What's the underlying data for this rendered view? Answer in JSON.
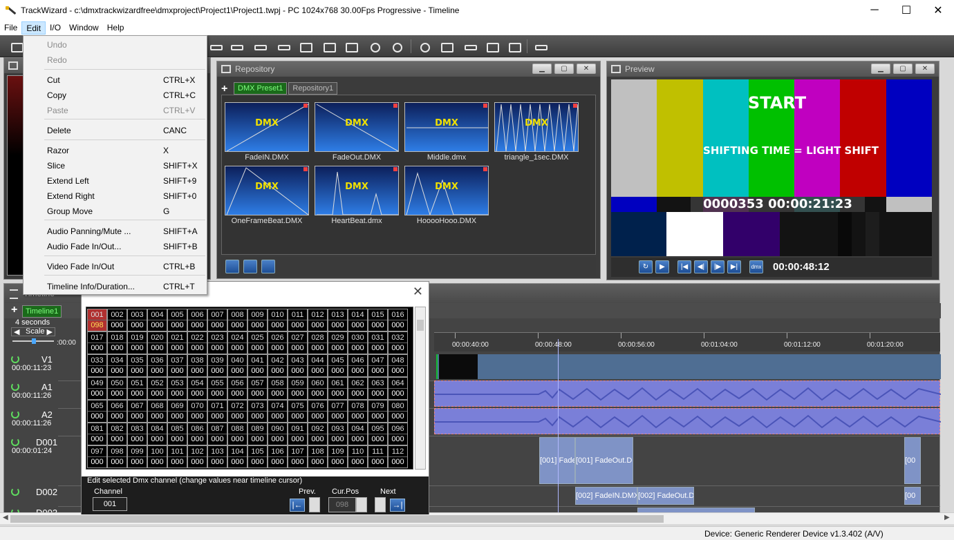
{
  "window": {
    "title": "TrackWizard - c:\\dmxtrackwizardfree\\dmxproject\\Project1\\Project1.twpj - PC 1024x768 30.00Fps Progressive - Timeline",
    "minimize": "─",
    "maximize": "☐",
    "close": "✕"
  },
  "menubar": [
    "File",
    "Edit",
    "I/O",
    "Window",
    "Help"
  ],
  "edit_menu": {
    "items": [
      {
        "label": "Undo",
        "shortcut": "",
        "disabled": true
      },
      {
        "label": "Redo",
        "shortcut": "",
        "disabled": true
      },
      {
        "label": "Cut",
        "shortcut": "CTRL+X",
        "disabled": false
      },
      {
        "label": "Copy",
        "shortcut": "CTRL+C",
        "disabled": false
      },
      {
        "label": "Paste",
        "shortcut": "CTRL+V",
        "disabled": true
      },
      {
        "label": "Delete",
        "shortcut": "CANC",
        "disabled": false
      },
      {
        "label": "Razor",
        "shortcut": "X",
        "disabled": false
      },
      {
        "label": "Slice",
        "shortcut": "SHIFT+X",
        "disabled": false
      },
      {
        "label": "Extend Left",
        "shortcut": "SHIFT+9",
        "disabled": false
      },
      {
        "label": "Extend Right",
        "shortcut": "SHIFT+0",
        "disabled": false
      },
      {
        "label": "Group Move",
        "shortcut": "G",
        "disabled": false
      },
      {
        "label": "Audio Panning/Mute ...",
        "shortcut": "SHIFT+A",
        "disabled": false
      },
      {
        "label": "Audio Fade In/Out...",
        "shortcut": "SHIFT+B",
        "disabled": false
      },
      {
        "label": "Video Fade In/Out",
        "shortcut": "CTRL+B",
        "disabled": false
      },
      {
        "label": "Timeline Info/Duration...",
        "shortcut": "CTRL+T",
        "disabled": false
      }
    ]
  },
  "repository": {
    "title": "Repository",
    "tabs": [
      "DMX Preset1",
      "Repository1"
    ],
    "thumb_label": "DMX",
    "presets": [
      "FadeIN.DMX",
      "FadeOut.DMX",
      "Middle.dmx",
      "triangle_1sec.DMX",
      "OneFrameBeat.DMX",
      "HeartBeat.dmx",
      "HooooHooo.DMX"
    ]
  },
  "preview": {
    "title": "Preview",
    "overlay_start": "START",
    "overlay_shift": "SHIFTING TIME = LIGHT SHIFT",
    "overlay_timecode": "0000353 00:00:21:23",
    "time": "00:00:48:12",
    "dmx_button": "dmx"
  },
  "timeline": {
    "title": "Timeline",
    "tab": "Timeline1",
    "scale_value": "4 seconds",
    "scale_label": "Scale",
    "ruler_left": ":00:00",
    "ruler": [
      "00:00:40:00",
      "00:00:48:00",
      "00:00:56:00",
      "00:01:04:00",
      "00:01:12:00",
      "00:01:20:00"
    ],
    "tracks": [
      {
        "name": "V1",
        "time": "00:00:11:23"
      },
      {
        "name": "A1",
        "time": "00:00:11:26"
      },
      {
        "name": "A2",
        "time": "00:00:11:26"
      },
      {
        "name": "D001",
        "time": "00:00:01:24"
      },
      {
        "name": "D002",
        "time": ""
      },
      {
        "name": "D003",
        "time": ""
      }
    ],
    "d001_clips": [
      "[001] Fade",
      "[001] FadeOut.D"
    ],
    "d002_clips": [
      "[002] FadeIN.DMX",
      "[002] FadeOut.D"
    ],
    "d_small": "[00"
  },
  "dmx_dialog": {
    "close": "✕",
    "edit_legend": "Edit selected Dmx channel (change values near timeline cursor)",
    "channel_label": "Channel",
    "channel_value": "001",
    "prev_label": "Prev.",
    "curpos_label": "Cur.Pos",
    "curpos_value": "098",
    "next_label": "Next",
    "selected_channel": 1,
    "selected_value": "098",
    "default_value": "000",
    "channel_count": 112
  },
  "statusbar": {
    "device": "Device: Generic Renderer Device v1.3.402 (A/V)"
  },
  "colors": {
    "accent_green": "#7fff7f",
    "selected_cell": "#b03030",
    "menu_highlight": "#cce8ff"
  }
}
